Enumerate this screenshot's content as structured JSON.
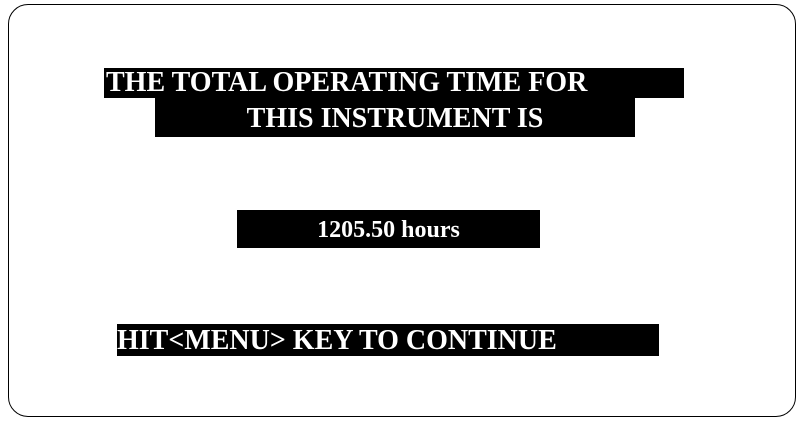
{
  "screen": {
    "title_line1": "THE TOTAL OPERATING TIME FOR",
    "title_line2": "THIS INSTRUMENT IS",
    "operating_time": "1205.50 hours",
    "prompt": "HIT<MENU> KEY TO CONTINUE"
  },
  "colors": {
    "background": "#ffffff",
    "highlight_bar": "#000000",
    "text": "#ffffff",
    "frame": "#000000"
  }
}
